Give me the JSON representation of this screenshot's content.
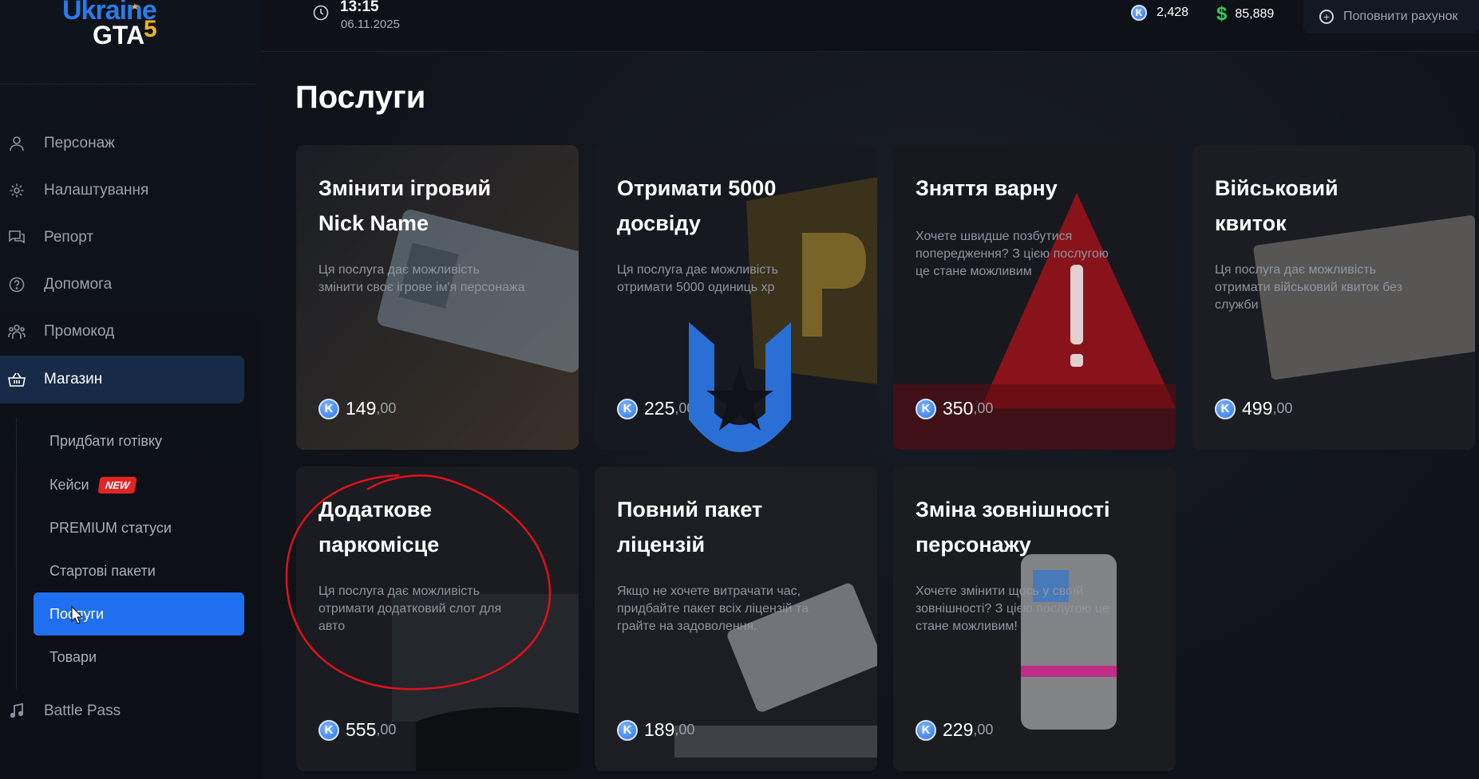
{
  "logo": {
    "part1": "Ukraine",
    "part2": "GTA",
    "part3": "5"
  },
  "header": {
    "time": "13:15",
    "date": "06.11.2025",
    "coins": "2,428",
    "cash": "85,889",
    "topup_label": "Поповнити рахунок",
    "coin_glyph": "K",
    "cash_glyph": "$"
  },
  "sidebar": {
    "items": [
      {
        "label": "Персонаж",
        "icon": "user-icon"
      },
      {
        "label": "Налаштування",
        "icon": "gear-icon"
      },
      {
        "label": "Репорт",
        "icon": "chat-icon"
      },
      {
        "label": "Допомога",
        "icon": "help-icon"
      },
      {
        "label": "Промокод",
        "icon": "people-icon"
      },
      {
        "label": "Магазин",
        "icon": "basket-icon",
        "active": true
      }
    ],
    "sub_items": [
      {
        "label": "Придбати готівку"
      },
      {
        "label": "Кейси",
        "badge": "NEW"
      },
      {
        "label": "PREMIUM статуси"
      },
      {
        "label": "Стартові пакети"
      },
      {
        "label": "Послуги",
        "active": true
      },
      {
        "label": "Товари"
      }
    ],
    "battle_pass": {
      "label": "Battle Pass",
      "icon": "music-icon"
    }
  },
  "main": {
    "title": "Послуги",
    "cards": [
      {
        "title_l1": "Змінити ігровий",
        "title_l2": "Nick Name",
        "desc": "Ця послуга дає можливість змінити своє ігрове ім'я персонажа",
        "price": "149",
        "cents": ",00"
      },
      {
        "title_l1": "Отримати 5000",
        "title_l2": "досвіду",
        "desc": "Ця послуга дає можливість отримати 5000 одиниць xp",
        "price": "225",
        "cents": ",00"
      },
      {
        "title_l1": "Зняття варну",
        "title_l2": "",
        "desc": "Хочете швидше позбутися попередження? З цією послугою це стане можливим",
        "price": "350",
        "cents": ",00"
      },
      {
        "title_l1": "Військовий",
        "title_l2": "квиток",
        "desc": "Ця послуга дає можливість отримати військовий квиток без служби",
        "price": "499",
        "cents": ",00"
      },
      {
        "title_l1": "Додаткове",
        "title_l2": "паркомісце",
        "desc": "Ця послуга дає можливість отримати додатковий слот для авто",
        "price": "555",
        "cents": ",00"
      },
      {
        "title_l1": "Повний пакет",
        "title_l2": "ліцензій",
        "desc": "Якщо не хочете витрачати час, придбайте пакет всіх ліцензій та грайте на задоволення.",
        "price": "189",
        "cents": ",00"
      },
      {
        "title_l1": "Зміна зовнішності",
        "title_l2": "персонажу",
        "desc": "Хочете змінити щось у своїй зовнішності? З цією послугою це стане можливим!",
        "price": "229",
        "cents": ",00"
      }
    ]
  },
  "colors": {
    "accent": "#1f6ff0",
    "active_bg": "#172a48",
    "cash": "#27d15a",
    "badge": "#e32424",
    "annotation": "#e0101a"
  }
}
